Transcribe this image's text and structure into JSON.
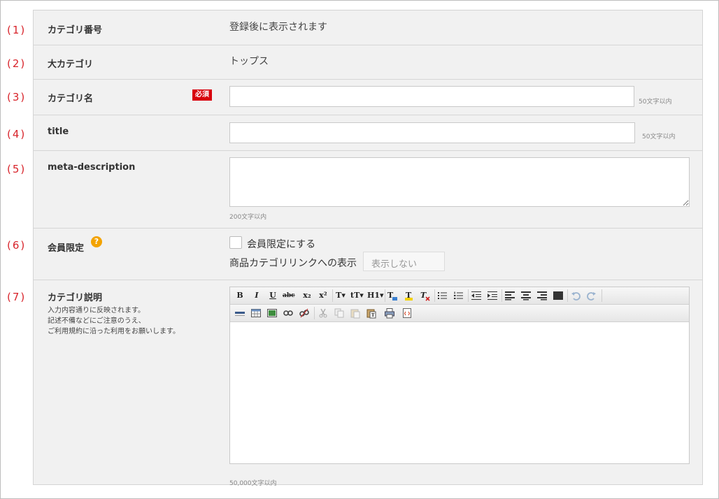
{
  "row_numbers": [
    "(1)",
    "(2)",
    "(3)",
    "(4)",
    "(5)",
    "(6)",
    "(7)"
  ],
  "rows": {
    "category_number": {
      "label": "カテゴリ番号",
      "value": "登録後に表示されます"
    },
    "parent_category": {
      "label": "大カテゴリ",
      "value": "トップス"
    },
    "category_name": {
      "label": "カテゴリ名",
      "required": "必須",
      "value": "",
      "hint": "50文字以内"
    },
    "title": {
      "label": "title",
      "value": "",
      "hint": "50文字以内"
    },
    "meta_description": {
      "label": "meta-description",
      "value": "",
      "hint": "200文字以内"
    },
    "members_only": {
      "label": "会員限定",
      "help_icon": "?",
      "checkbox_label": "会員限定にする",
      "link_display_label": "商品カテゴリリンクへの表示",
      "link_display_value": "表示しない"
    },
    "category_description": {
      "label": "カテゴリ説明",
      "note_lines": [
        "入力内容通りに反映されます。",
        "記述不備などにご注意のうえ、",
        "ご利用規約に沿った利用をお願いします。"
      ],
      "hint": "50,000文字以内"
    }
  },
  "toolbar_row1": [
    {
      "name": "bold-button",
      "glyph": "B"
    },
    {
      "name": "italic-button",
      "glyph": "I"
    },
    {
      "name": "underline-button",
      "glyph": "U"
    },
    {
      "name": "strikethrough-button",
      "glyph": "abc"
    },
    {
      "name": "subscript-button",
      "glyph": "x₂"
    },
    {
      "name": "superscript-button",
      "glyph": "x²"
    },
    {
      "name": "font-family-button",
      "glyph": "T▾"
    },
    {
      "name": "font-size-button",
      "glyph": "tT▾"
    },
    {
      "name": "heading-button",
      "glyph": "H1▾"
    }
  ],
  "colors": {
    "accent_red": "#d8242b",
    "required_bg": "#d8000c",
    "help_orange": "#f3a300",
    "panel_bg": "#f1f1f1"
  }
}
